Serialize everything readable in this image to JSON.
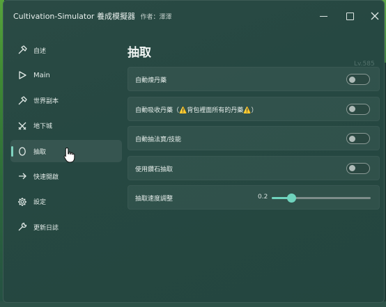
{
  "window": {
    "title": "Cultivation-Simulator 養成模擬器",
    "author": "作者：澤澤"
  },
  "sidebar": {
    "items": [
      {
        "label": "自述",
        "icon": "hammer-icon"
      },
      {
        "label": "Main",
        "icon": "play-icon"
      },
      {
        "label": "世界副本",
        "icon": "hammer-icon"
      },
      {
        "label": "地下城",
        "icon": "crossed-swords-icon"
      },
      {
        "label": "抽取",
        "icon": "egg-icon",
        "active": true
      },
      {
        "label": "快速開啟",
        "icon": "arrow-right-icon"
      },
      {
        "label": "設定",
        "icon": "gear-icon"
      },
      {
        "label": "更新日誌",
        "icon": "wrench-icon"
      }
    ]
  },
  "page": {
    "title": "抽取",
    "rows": [
      {
        "label": "自動煉丹藥",
        "type": "toggle",
        "on": false
      },
      {
        "label": "自動吸收丹藥（",
        "warn_text": "背包裡面所有的丹藥",
        "type": "toggle",
        "on": false
      },
      {
        "label": "自動抽法寶/技能",
        "type": "toggle",
        "on": false
      },
      {
        "label": "使用鑽石抽取",
        "type": "toggle",
        "on": false
      },
      {
        "label": "抽取速度調整",
        "type": "slider",
        "value": "0.2",
        "fraction": 0.2
      }
    ]
  },
  "background": {
    "ghost_text": "Lv.585"
  },
  "colors": {
    "accent": "#6fd3bd",
    "warning": "#f2c230"
  }
}
